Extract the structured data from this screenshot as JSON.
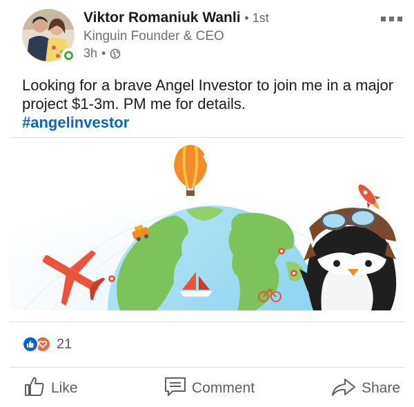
{
  "post": {
    "author": {
      "name": "Viktor Romaniuk Wanli",
      "degree": "• 1st",
      "headline": "Kinguin Founder & CEO",
      "time": "3h",
      "time_separator": "•",
      "visibility_icon": "globe-icon",
      "online_status": "online"
    },
    "more_icon": "more-options-icon",
    "text": "Looking for a brave Angel Investor to join me in a major project $1-3m. PM me for details.",
    "hashtag": "#angelinvestor"
  },
  "reactions": {
    "icons": [
      "like-reaction-icon",
      "love-reaction-icon"
    ],
    "count": "21"
  },
  "actions": {
    "like_label": "Like",
    "comment_label": "Comment",
    "share_label": "Share"
  },
  "colors": {
    "link": "#0a66c2",
    "online": "#45a63e",
    "love": "#df704d"
  }
}
